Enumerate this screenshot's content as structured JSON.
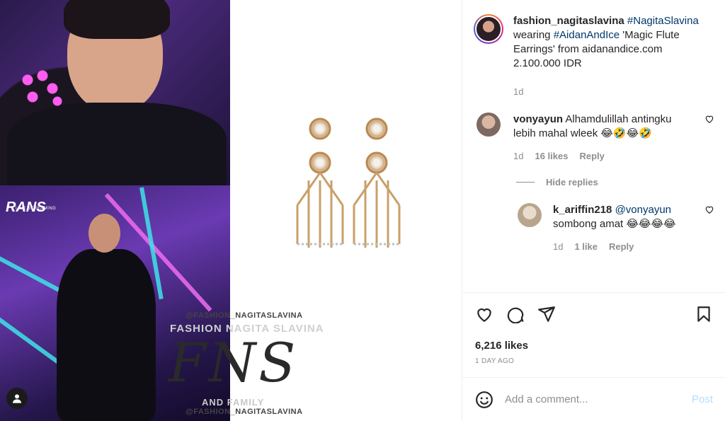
{
  "caption": {
    "username": "fashion_nagitaslavina",
    "tag1": "#NagitaSlavina",
    "text_wearing": "wearing",
    "tag2": "#AidanAndIce",
    "text_rest": "'Magic Flute Earrings' from aidanandice.com 2.100.000 IDR",
    "time": "1d"
  },
  "comments": [
    {
      "username": "vonyayun",
      "text": "Alhamdulillah antingku lebih mahal wleek 😂🤣😂🤣",
      "time": "1d",
      "likes": "16 likes",
      "reply": "Reply"
    }
  ],
  "hide_replies": "Hide replies",
  "reply": {
    "username": "k_ariffin218",
    "mention": "@vonyayun",
    "text": "sombong amat 😂😂😂😂",
    "time": "1d",
    "likes": "1 like",
    "reply": "Reply"
  },
  "post": {
    "likes": "6,216 likes",
    "age": "1 DAY AGO"
  },
  "add_comment": {
    "placeholder": "Add a comment...",
    "post_label": "Post"
  },
  "media": {
    "brand": "RANS",
    "brand_sub": "LIVE STREAMING",
    "watermark_handle": "@FASHION_NAGITASLAVINA",
    "watermark_name": "FASHION NAGITA SLAVINA",
    "watermark_logo": "FNS",
    "watermark_family": "AND FAMILY"
  },
  "icons": [
    "heart-icon",
    "comment-icon",
    "share-icon",
    "bookmark-icon",
    "emoji-icon",
    "user-icon"
  ]
}
